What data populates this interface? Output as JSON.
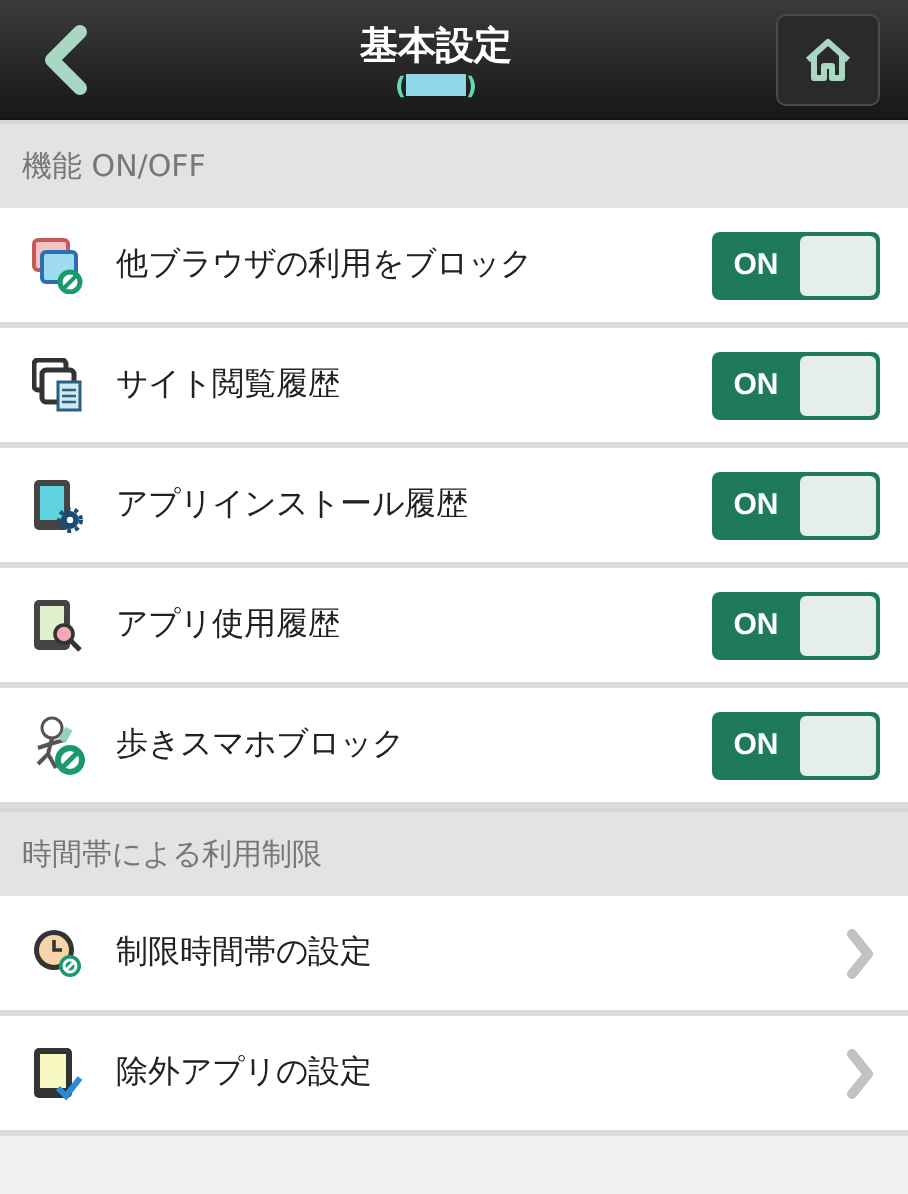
{
  "header": {
    "title": "基本設定",
    "subtitle_open": "(",
    "subtitle_close": ")"
  },
  "sections": [
    {
      "title": "機能 ON/OFF",
      "items": [
        {
          "kind": "toggle",
          "label": "他ブラウザの利用をブロック",
          "on": true,
          "state_label": "ON"
        },
        {
          "kind": "toggle",
          "label": "サイト閲覧履歴",
          "on": true,
          "state_label": "ON"
        },
        {
          "kind": "toggle",
          "label": "アプリインストール履歴",
          "on": true,
          "state_label": "ON"
        },
        {
          "kind": "toggle",
          "label": "アプリ使用履歴",
          "on": true,
          "state_label": "ON"
        },
        {
          "kind": "toggle",
          "label": "歩きスマホブロック",
          "on": true,
          "state_label": "ON"
        }
      ]
    },
    {
      "title": "時間帯による利用制限",
      "items": [
        {
          "kind": "link",
          "label": "制限時間帯の設定"
        },
        {
          "kind": "link",
          "label": "除外アプリの設定"
        }
      ]
    }
  ]
}
